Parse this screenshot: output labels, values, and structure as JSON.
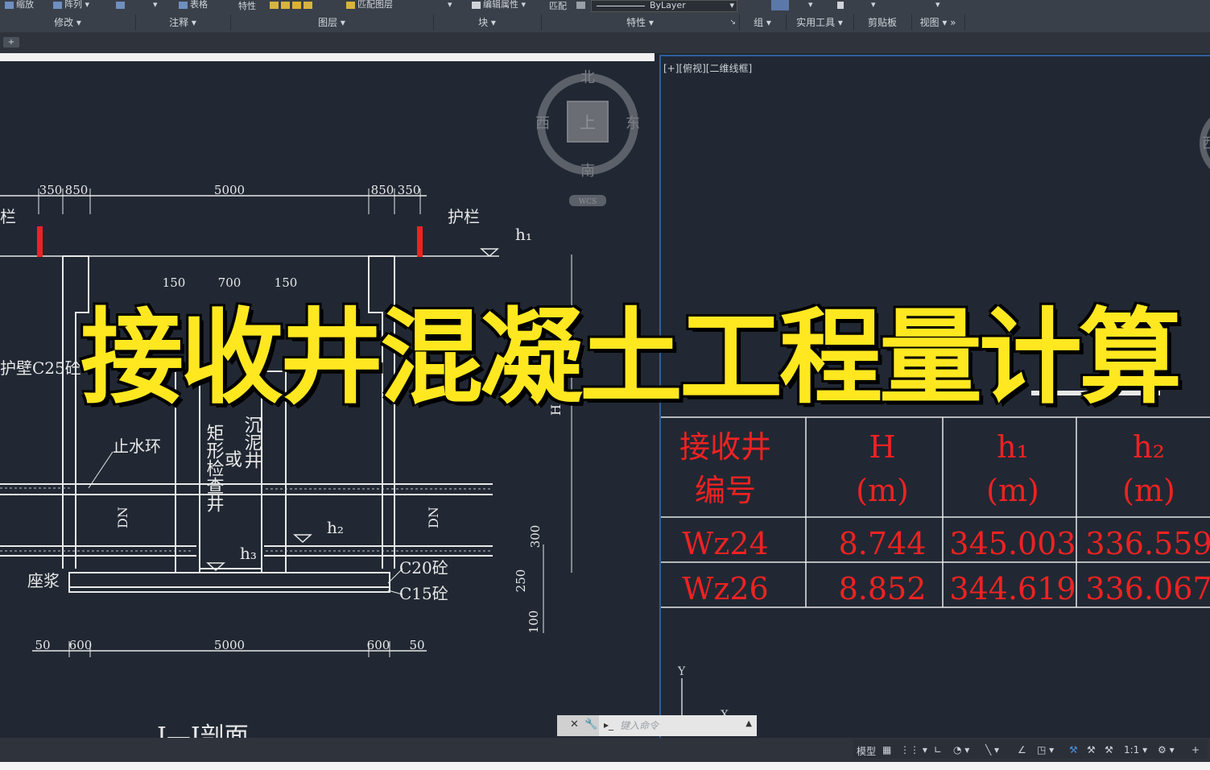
{
  "ribbon": {
    "top_items": [
      "缩放",
      "阵列",
      "表格",
      "特性",
      "匹配图层",
      "编辑属性",
      "匹配",
      "ByLayer"
    ],
    "panels": [
      "修改",
      "注释",
      "图层",
      "块",
      "特性",
      "组",
      "实用工具",
      "剪贴板",
      "视图"
    ]
  },
  "file_tab": {
    "plus": "+"
  },
  "viewport_right": {
    "label": "[+][俯视][二维线框]"
  },
  "viewcube_left": {
    "north": "北",
    "south": "南",
    "east": "东",
    "west": "西",
    "top_face": "上",
    "wcs": "WCS"
  },
  "viewcube_right": {
    "west": "西"
  },
  "drawing": {
    "dims_top": [
      "350",
      "850",
      "5000",
      "850",
      "350"
    ],
    "dims_inner": [
      "150",
      "700",
      "150"
    ],
    "dims_bottom": [
      "50",
      "600",
      "5000",
      "600",
      "50"
    ],
    "dims_right": [
      "300",
      "250",
      "100"
    ],
    "labels": {
      "guardrail_left": "栏",
      "guardrail_right": "护栏",
      "wall": "护壁C25砼",
      "waterstop": "止水环",
      "mortar": "座浆",
      "c20": "C20砼",
      "c15": "C15砼",
      "h1": "h₁",
      "h2": "h₂",
      "h3": "h₃",
      "H": "H",
      "DN": "DN",
      "well_left": "矩形检查井",
      "well_or": "或",
      "well_right": "沉泥井",
      "section": "I—I剖面"
    }
  },
  "table": {
    "headers": [
      [
        "接收井",
        "编号"
      ],
      [
        "H",
        "(m)"
      ],
      [
        "h₁",
        "(m)"
      ],
      [
        "h₂",
        "(m)"
      ]
    ],
    "rows": [
      [
        "Wz24",
        "8.744",
        "345.003",
        "336.559"
      ],
      [
        "Wz26",
        "8.852",
        "344.619",
        "336.067"
      ]
    ]
  },
  "overlay_title": "接收井混凝土工程量计算",
  "cmdline": {
    "placeholder": "键入命令"
  },
  "status": {
    "model": "模型",
    "scale": "1:1"
  },
  "ucs": {
    "x": "X",
    "y": "Y"
  },
  "colors": {
    "accent": "#ffe820",
    "table_red": "#ee2222",
    "viewport_border": "#2f5f9a",
    "bg": "#212833"
  }
}
